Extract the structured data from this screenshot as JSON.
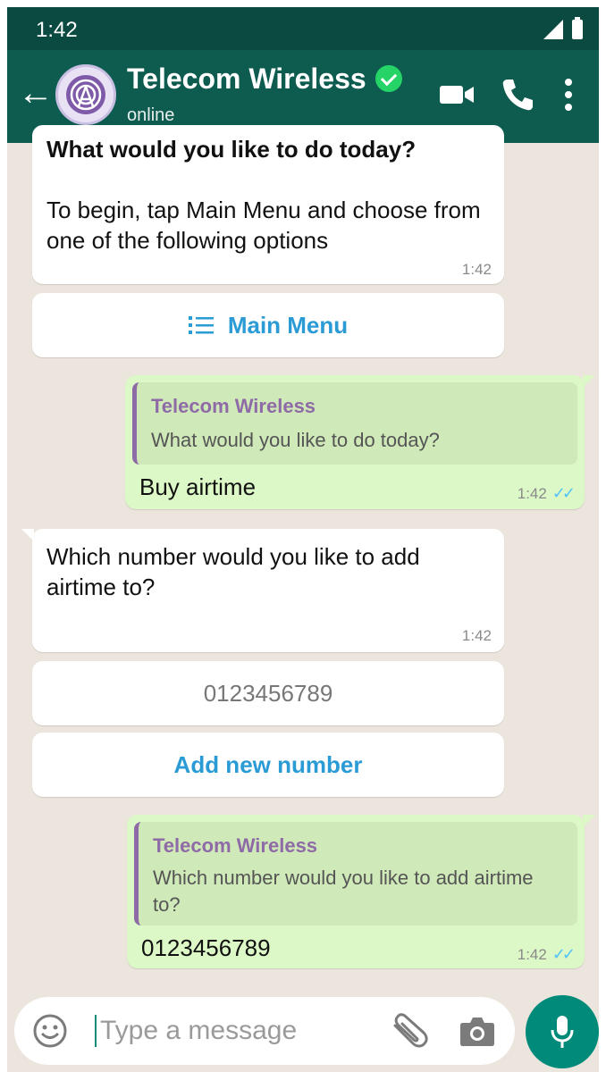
{
  "status_bar": {
    "time": "1:42"
  },
  "header": {
    "contact_name": "Telecom Wireless",
    "contact_status": "online"
  },
  "messages": {
    "m1": {
      "title": "What would you like to do today?",
      "body": "To begin, tap Main Menu and choose from one of the following options",
      "time": "1:42",
      "button_label": "Main Menu"
    },
    "m2": {
      "quote_name": "Telecom Wireless",
      "quote_text": "What would you like to do today?",
      "text": "Buy airtime",
      "time": "1:42"
    },
    "m3": {
      "text": "Which number would you like to add airtime to?",
      "time": "1:42",
      "option_number": "0123456789",
      "option_add": "Add new number"
    },
    "m4": {
      "quote_name": "Telecom Wireless",
      "quote_text": "Which number would you like to add airtime to?",
      "text": "0123456789",
      "time": "1:42"
    }
  },
  "input": {
    "placeholder": "Type a message"
  },
  "icons": {
    "back": "back-arrow-icon",
    "video": "video-call-icon",
    "call": "phone-icon",
    "more": "more-vertical-icon",
    "menu": "list-icon",
    "emoji": "emoji-icon",
    "attach": "paperclip-icon",
    "camera": "camera-icon",
    "mic": "microphone-icon"
  },
  "colors": {
    "header": "#0e5c4f",
    "status_bar": "#0b4a40",
    "outgoing_bubble": "#dcf8c6",
    "link_blue": "#2a9bd4",
    "quote_name": "#8e6aa6",
    "mic_button": "#008a7a"
  }
}
